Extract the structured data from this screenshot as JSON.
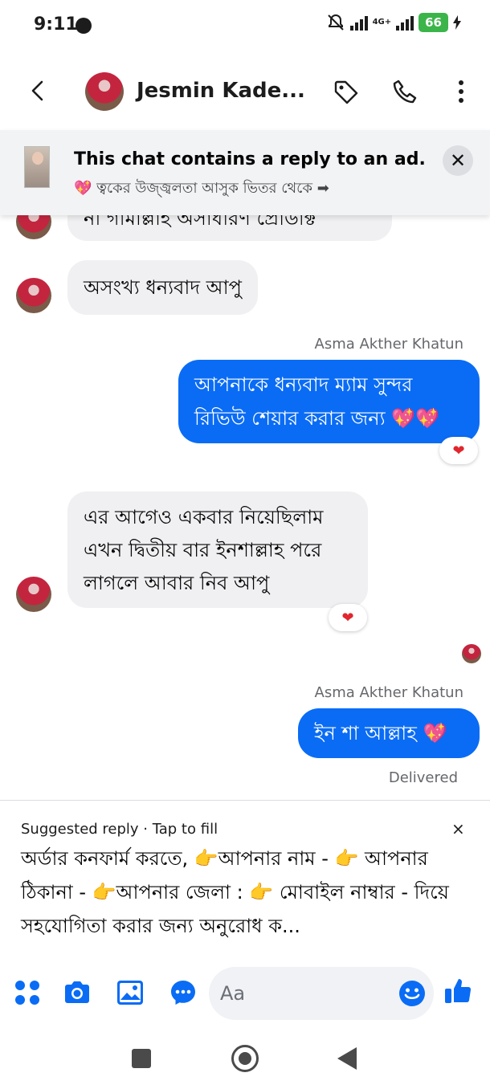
{
  "status_bar": {
    "time": "9:11",
    "network": "4G+",
    "battery": "66"
  },
  "header": {
    "contact_name": "Jesmin Kade...",
    "icons": [
      "back-arrow-icon",
      "tag-icon",
      "phone-icon",
      "more-vert-icon"
    ]
  },
  "ad_banner": {
    "title": "This chat contains a reply to an ad.",
    "subtitle": "💖 ত্বকের উজ্জ্বলতা আসুক ভিতর থেকে ➡",
    "close": "✕"
  },
  "messages": [
    {
      "direction": "in",
      "text": "না গামাল্লাহ অসাধারণ প্রোডাক্ট"
    },
    {
      "direction": "in",
      "text": "অসংখ্য ধন্যবাদ আপু"
    },
    {
      "direction": "out",
      "sender": "Asma Akther Khatun",
      "line1": "আপনাকে ধন্যবাদ ম্যাম সুন্দর",
      "line2": "রিভিউ শেয়ার করার জন্য 💖💖",
      "reaction": "❤"
    },
    {
      "direction": "in",
      "line1": "এর আগেও একবার নিয়েছিলাম",
      "line2": "এখন দ্বিতীয় বার ইনশাল্লাহ পরে",
      "line3": "লাগলে আবার নিব আপু",
      "reaction": "❤"
    },
    {
      "direction": "out",
      "sender": "Asma Akther Khatun",
      "text": "ইন শা আল্লাহ 💖",
      "status": "Delivered"
    }
  ],
  "suggestion": {
    "header": "Suggested reply · Tap to fill",
    "close": "×",
    "text": "অর্ডার কনফার্ম করতে, 👉আপনার নাম - 👉 আপনার ঠিকানা - 👉আপনার জেলা : 👉 মোবাইল নাম্বার - দিয়ে সহযোগিতা করার জন্য অনুরোধ ক..."
  },
  "composer": {
    "placeholder": "Aa",
    "icons": [
      "apps-icon",
      "camera-icon",
      "gallery-icon",
      "chat-bubble-icon",
      "emoji-icon",
      "thumbs-up-icon"
    ]
  },
  "colors": {
    "accent": "#0a6cf5",
    "incoming_bubble": "#f0f0f2"
  }
}
